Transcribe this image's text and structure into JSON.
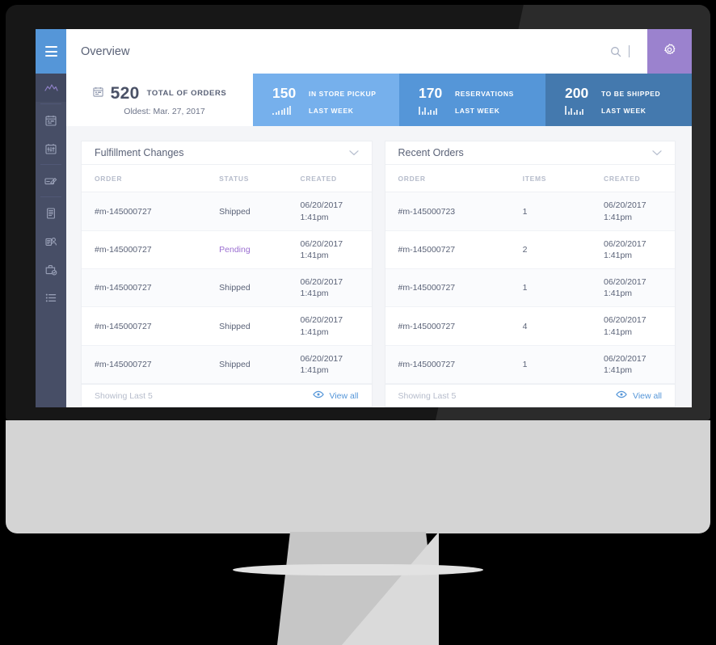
{
  "header": {
    "title": "Overview",
    "menu_icon": "hamburger-menu-icon",
    "search_icon": "search-icon",
    "search_value": "",
    "search_placeholder": "",
    "gear_icon": "gear-icon"
  },
  "sidebar": {
    "items": [
      {
        "icon": "analytics-mountain-icon",
        "active": true
      },
      {
        "icon": "calendar-icon",
        "active": false
      },
      {
        "icon": "sliders-panel-icon",
        "active": false
      },
      {
        "icon": "card-edit-icon",
        "active": false
      },
      {
        "icon": "document-list-icon",
        "active": false
      },
      {
        "icon": "contact-card-icon",
        "active": false
      },
      {
        "icon": "briefcase-check-icon",
        "active": false
      },
      {
        "icon": "list-bullets-icon",
        "active": false
      }
    ]
  },
  "stats": {
    "total": {
      "icon": "calendar-icon",
      "value": "520",
      "label": "TOTAL OF ORDERS",
      "sub": "Oldest:  Mar. 27, 2017"
    },
    "tiles": [
      {
        "value": "150",
        "label": "IN STORE PICKUP",
        "period": "LAST WEEK",
        "color": "#76b0ec",
        "spark": [
          2,
          3,
          5,
          6,
          8,
          9,
          11
        ]
      },
      {
        "value": "170",
        "label": "RESERVATIONS",
        "period": "LAST WEEK",
        "color": "#5596d8",
        "spark": [
          10,
          4,
          9,
          3,
          6,
          5,
          8
        ]
      },
      {
        "value": "200",
        "label": "TO BE SHIPPED",
        "period": "LAST WEEK",
        "color": "#4479ae",
        "spark": [
          11,
          4,
          8,
          3,
          6,
          4,
          7
        ]
      }
    ]
  },
  "panels": [
    {
      "title": "Fulfillment Changes",
      "chevron_icon": "chevron-down-icon",
      "columns": [
        "ORDER",
        "STATUS",
        "CREATED"
      ],
      "rows": [
        {
          "order": "#m-145000727",
          "value": "Shipped",
          "pending": false,
          "date": "06/20/2017",
          "time": "1:41pm"
        },
        {
          "order": "#m-145000727",
          "value": "Pending",
          "pending": true,
          "date": "06/20/2017",
          "time": "1:41pm"
        },
        {
          "order": "#m-145000727",
          "value": "Shipped",
          "pending": false,
          "date": "06/20/2017",
          "time": "1:41pm"
        },
        {
          "order": "#m-145000727",
          "value": "Shipped",
          "pending": false,
          "date": "06/20/2017",
          "time": "1:41pm"
        },
        {
          "order": "#m-145000727",
          "value": "Shipped",
          "pending": false,
          "date": "06/20/2017",
          "time": "1:41pm"
        }
      ],
      "footer": {
        "showing": "Showing Last 5",
        "view_all": "View all",
        "eye_icon": "eye-icon"
      }
    },
    {
      "title": "Recent Orders",
      "chevron_icon": "chevron-down-icon",
      "columns": [
        "ORDER",
        "ITEMS",
        "CREATED"
      ],
      "rows": [
        {
          "order": "#m-145000723",
          "value": "1",
          "pending": false,
          "date": "06/20/2017",
          "time": "1:41pm"
        },
        {
          "order": "#m-145000727",
          "value": "2",
          "pending": false,
          "date": "06/20/2017",
          "time": "1:41pm"
        },
        {
          "order": "#m-145000727",
          "value": "1",
          "pending": false,
          "date": "06/20/2017",
          "time": "1:41pm"
        },
        {
          "order": "#m-145000727",
          "value": "4",
          "pending": false,
          "date": "06/20/2017",
          "time": "1:41pm"
        },
        {
          "order": "#m-145000727",
          "value": "1",
          "pending": false,
          "date": "06/20/2017",
          "time": "1:41pm"
        }
      ],
      "footer": {
        "showing": "Showing Last 5",
        "view_all": "View all",
        "eye_icon": "eye-icon"
      }
    }
  ],
  "colors": {
    "accent_blue": "#5596d8",
    "accent_purple": "#9b82ce",
    "pending_purple": "#9b6fd1",
    "sidebar": "#474e66",
    "app_bg": "#f4f5f8"
  }
}
